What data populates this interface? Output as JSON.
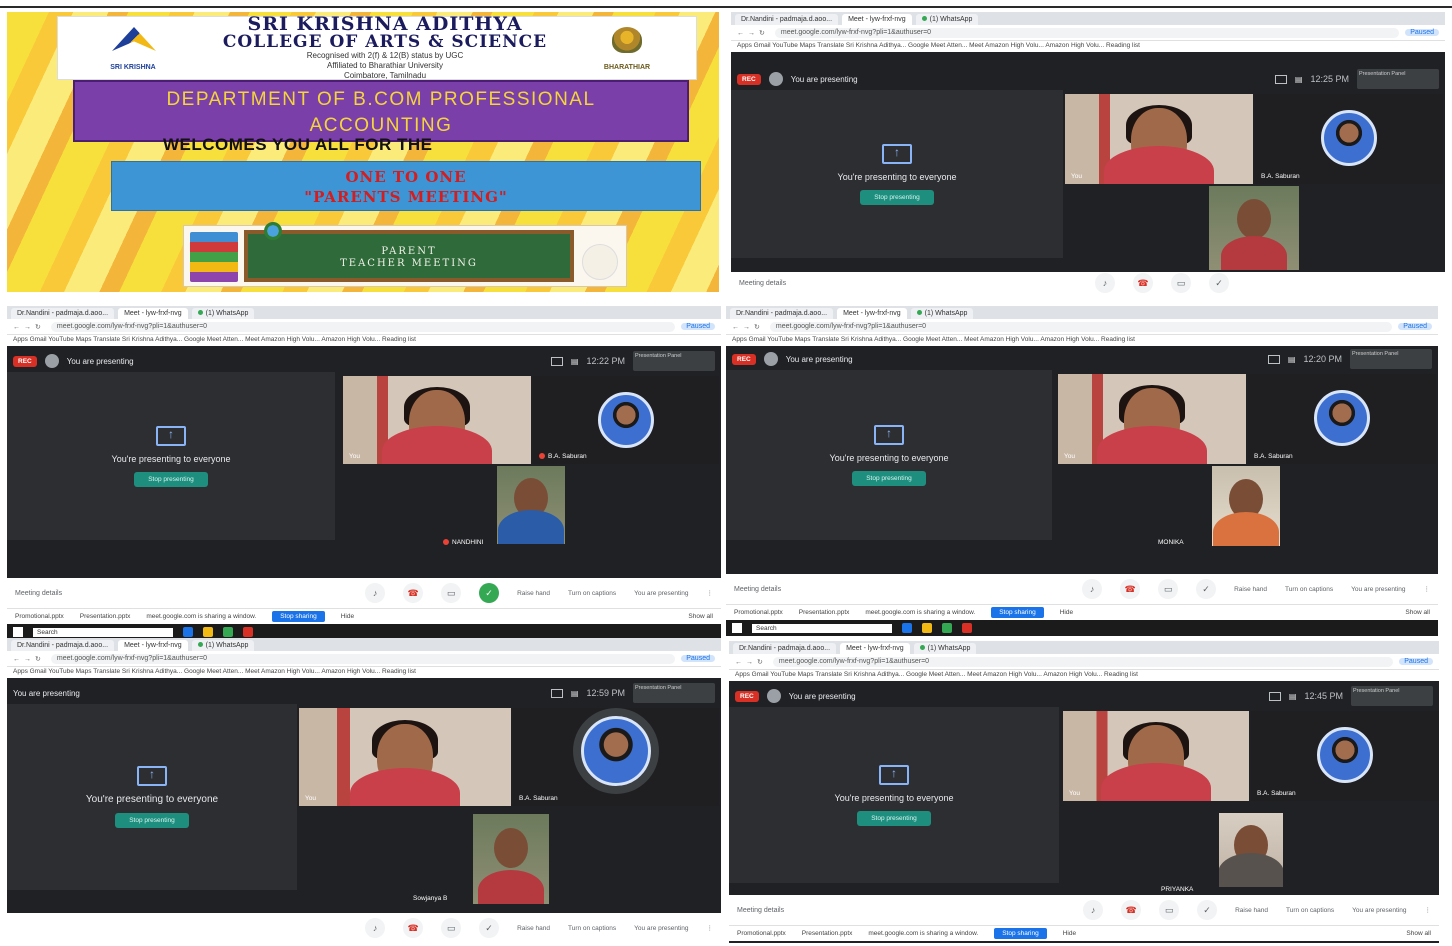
{
  "banner": {
    "college_line1": "SRI KRISHNA ADITHYA",
    "college_line2": "COLLEGE OF ARTS & SCIENCE",
    "college_sub1": "Recognised with 2(f) & 12(B) status by UGC",
    "college_sub2": "Affiliated to Bharathiar University",
    "college_sub3": "Coimbatore, Tamilnadu",
    "logo_left": "SRI KRISHNA",
    "logo_right": "BHARATHIAR",
    "dept_line1": "DEPARTMENT OF B.COM PROFESSIONAL",
    "dept_line2": "ACCOUNTING",
    "welcome": "WELCOMES YOU ALL FOR THE",
    "meeting_line1": "ONE TO ONE",
    "meeting_line2": "\"PARENTS MEETING\"",
    "board_line1": "PARENT",
    "board_line2": "TEACHER MEETING"
  },
  "common": {
    "tab_meet": "Meet - lyw-frxf-nvg",
    "tab_other": "Dr.Nandini - padmaja.d.aoo...",
    "tab_whatsapp": "(1) WhatsApp",
    "url": "meet.google.com/lyw-frxf-nvg?pli=1&authuser=0",
    "paused": "Paused",
    "bookmarks": "Apps   Gmail   YouTube   Maps   Translate   Sri Krishna Adithya...   Google Meet Atten...   Meet   Amazon High Volu...   Amazon High Volu...   Reading list",
    "rec": "REC",
    "you_presenting": "You are presenting",
    "presenting_msg": "You're presenting to everyone",
    "stop_btn": "Stop presenting",
    "you_label": "You",
    "teacher_label": "B.A. Saburan",
    "meeting_details": "Meeting details",
    "raise_hand": "Raise hand",
    "captions": "Turn on captions",
    "you_are_presenting_btn": "You are presenting",
    "mini_label": "Presentation Panel",
    "download1": "Promotional.pptx",
    "download2": "Presentation.pptx",
    "share_notice": "meet.google.com is sharing a window.",
    "stop_sharing": "Stop sharing",
    "hide": "Hide",
    "show_all": "Show all",
    "search": "Search"
  },
  "panels": [
    {
      "clock": "12:25 PM",
      "parent": ""
    },
    {
      "clock": "12:22 PM",
      "parent": "NANDHINI"
    },
    {
      "clock": "12:20 PM",
      "parent": "MONIKA"
    },
    {
      "clock": "12:59 PM",
      "parent": "Sowjanya B"
    },
    {
      "clock": "12:45 PM",
      "parent": "PRIYANKA"
    }
  ],
  "colors": {
    "meet_bg": "#202124",
    "present_accent": "#1e8e7e",
    "rec": "#d93025",
    "dept_purple": "#7a3fa8",
    "meeting_blue": "#3d95d6"
  }
}
